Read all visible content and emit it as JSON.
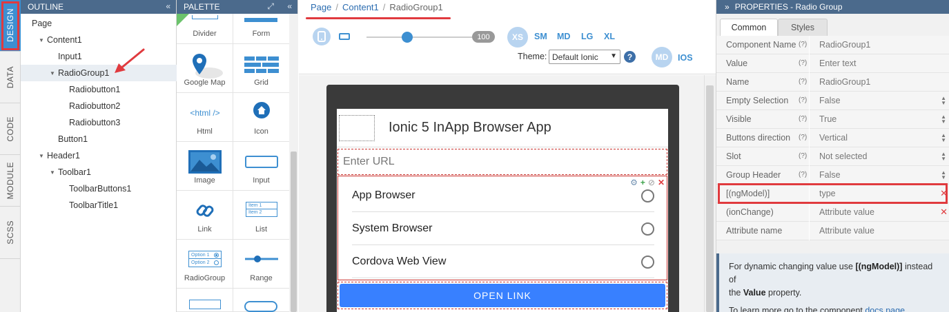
{
  "vtabs": {
    "design": "DESIGN",
    "data": "DATA",
    "code": "CODE",
    "module": "MODULE",
    "scss": "SCSS"
  },
  "outline": {
    "title": "OUTLINE",
    "collapse": "«",
    "items": [
      {
        "label": "Page",
        "level": 0,
        "expand": ""
      },
      {
        "label": "Content1",
        "level": 1,
        "expand": "▼"
      },
      {
        "label": "Input1",
        "level": 2,
        "expand": ""
      },
      {
        "label": "RadioGroup1",
        "level": 2,
        "expand": "▼"
      },
      {
        "label": "Radiobutton1",
        "level": 3,
        "expand": ""
      },
      {
        "label": "Radiobutton2",
        "level": 3,
        "expand": ""
      },
      {
        "label": "Radiobutton3",
        "level": 3,
        "expand": ""
      },
      {
        "label": "Button1",
        "level": 2,
        "expand": ""
      },
      {
        "label": "Header1",
        "level": 1,
        "expand": "▼"
      },
      {
        "label": "Toolbar1",
        "level": 2,
        "expand": "▼"
      },
      {
        "label": "ToolbarButtons1",
        "level": 3,
        "expand": ""
      },
      {
        "label": "ToolbarTitle1",
        "level": 3,
        "expand": ""
      }
    ]
  },
  "palette": {
    "title": "PALETTE",
    "expand": "⤢",
    "collapse": "«",
    "items": [
      "Divider",
      "Form",
      "Google Map",
      "Grid",
      "Html",
      "Icon",
      "Image",
      "Input",
      "Link",
      "List",
      "RadioGroup",
      "Range"
    ],
    "html_glyph": "<html />",
    "list_glyph_1": "Item 1",
    "list_glyph_2": "Item 2",
    "radio_glyph_1": "Option 1",
    "radio_glyph_2": "Option 2"
  },
  "breadcrumb": {
    "page": "Page",
    "content": "Content1",
    "current": "RadioGroup1",
    "sep": "/"
  },
  "toolbar": {
    "zoom_value": "100",
    "slider_level": 0.37,
    "breakpoints": [
      "XS",
      "SM",
      "MD",
      "LG",
      "XL"
    ],
    "theme_label": "Theme:",
    "theme_value": "Default Ionic",
    "help": "?",
    "mode_md": "MD",
    "mode_ios": "IOS"
  },
  "app": {
    "title": "Ionic 5 InApp Browser App",
    "url_placeholder": "Enter URL",
    "radio_options": [
      "App Browser",
      "System Browser",
      "Cordova Web View"
    ],
    "button_label": "OPEN LINK"
  },
  "properties": {
    "title": "PROPERTIES - Radio Group",
    "expand": "»",
    "tabs": [
      "Common",
      "Styles"
    ],
    "rows": [
      {
        "name": "Component Name",
        "help": "(?)",
        "value": "RadioGroup1",
        "spin": false,
        "remove": false
      },
      {
        "name": "Value",
        "help": "(?)",
        "value": "Enter text",
        "spin": false,
        "remove": false
      },
      {
        "name": "Name",
        "help": "(?)",
        "value": "RadioGroup1",
        "spin": false,
        "remove": false
      },
      {
        "name": "Empty Selection",
        "help": "(?)",
        "value": "False",
        "spin": true,
        "remove": false
      },
      {
        "name": "Visible",
        "help": "(?)",
        "value": "True",
        "spin": true,
        "remove": false
      },
      {
        "name": "Buttons direction",
        "help": "(?)",
        "value": "Vertical",
        "spin": true,
        "remove": false
      },
      {
        "name": "Slot",
        "help": "(?)",
        "value": "Not selected",
        "spin": true,
        "remove": false
      },
      {
        "name": "Group Header",
        "help": "(?)",
        "value": "False",
        "spin": true,
        "remove": false
      },
      {
        "name": "[(ngModel)]",
        "help": "",
        "value": "type",
        "spin": false,
        "remove": true
      },
      {
        "name": "(ionChange)",
        "help": "",
        "value": "Attribute value",
        "spin": false,
        "remove": true
      },
      {
        "name": "Attribute name",
        "help": "",
        "value": "Attribute value",
        "spin": false,
        "remove": false
      }
    ],
    "info": {
      "line1_pre": "For dynamic changing value use ",
      "line1_bold": "[(ngModel)]",
      "line1_post": " instead of",
      "line2_pre": "the ",
      "line2_bold": "Value",
      "line2_post": " property.",
      "line3_pre": "To learn more go to the component ",
      "line3_link": "docs page",
      "line3_post": "."
    }
  },
  "colors": {
    "accent": "#3d8fd1",
    "header": "#4b6a8c",
    "annotation": "#e03a3e",
    "ionic_primary": "#3880ff"
  }
}
